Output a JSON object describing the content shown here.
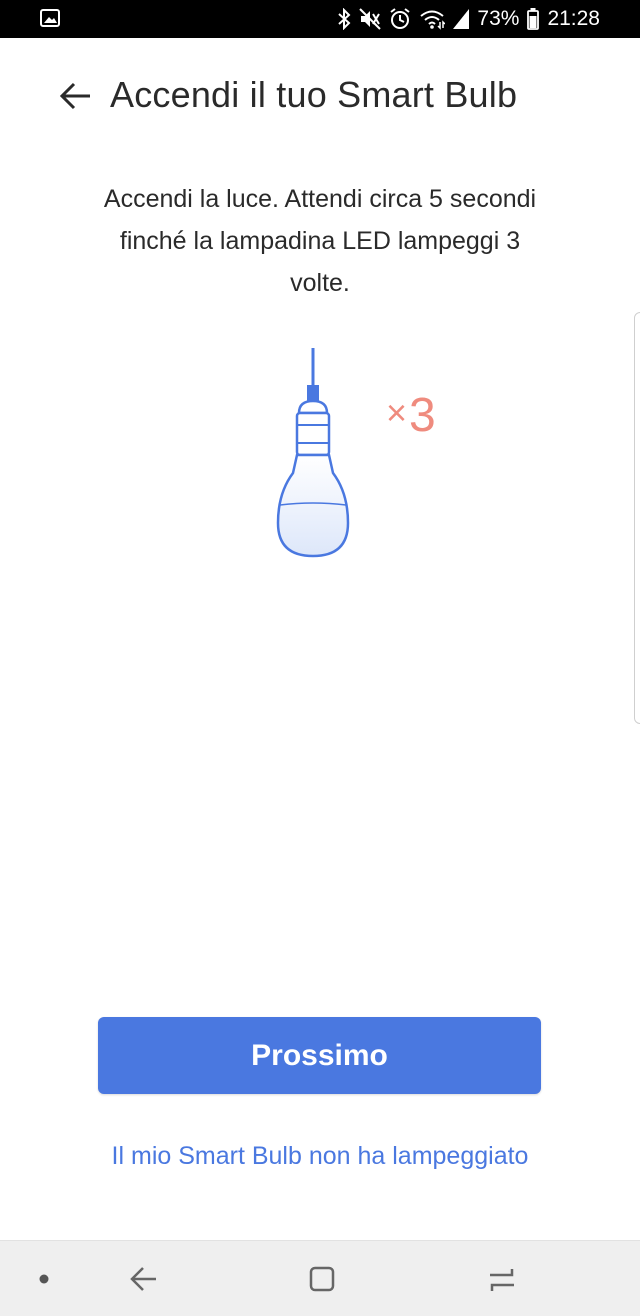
{
  "status_bar": {
    "battery": "73%",
    "time": "21:28",
    "icons": [
      "image-icon",
      "bluetooth-icon",
      "mute-icon",
      "alarm-icon",
      "wifi-icon",
      "signal-icon",
      "battery-icon"
    ]
  },
  "header": {
    "title": "Accendi il tuo Smart Bulb",
    "back_icon": "arrow-left-icon"
  },
  "instruction": "Accendi la luce. Attendi circa 5 secondi finché la lampadina LED lampeggi 3 volte.",
  "illustration": {
    "icon": "light-bulb-icon",
    "times_symbol": "×",
    "times_value": "3"
  },
  "primary_button": {
    "label": "Prossimo"
  },
  "secondary_link": {
    "label": "Il mio Smart Bulb non ha lampeggiato"
  },
  "nav_bar": {
    "items": [
      "dot-icon",
      "back-icon",
      "home-icon",
      "recents-icon"
    ]
  },
  "colors": {
    "accent": "#4a78e0",
    "times": "#ef8b7e",
    "bulb_outline": "#4a78e0",
    "bulb_fill": "#eef3fc"
  }
}
